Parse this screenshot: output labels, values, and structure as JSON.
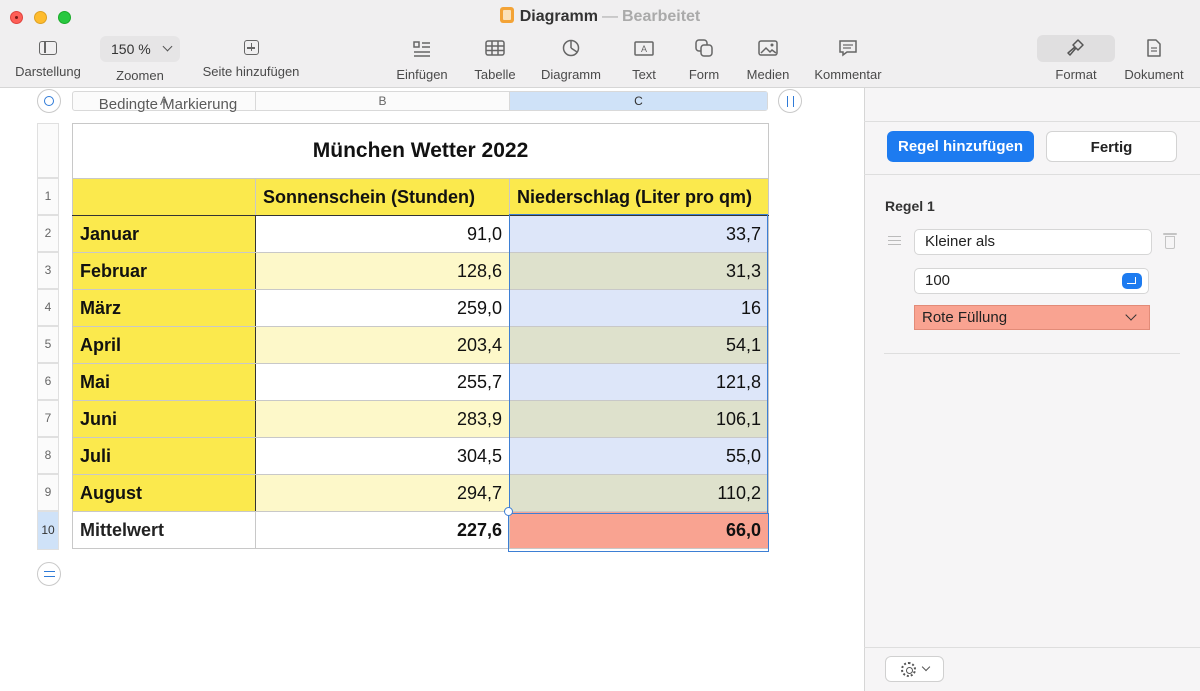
{
  "window": {
    "title": "Diagramm",
    "separator": "—",
    "status": "Bearbeitet"
  },
  "toolbar": {
    "zoom_value": "150 %",
    "items": {
      "darstellung": "Darstellung",
      "zoomen": "Zoomen",
      "seite_hinzufuegen": "Seite hinzufügen",
      "einfuegen": "Einfügen",
      "tabelle": "Tabelle",
      "diagramm": "Diagramm",
      "text": "Text",
      "form": "Form",
      "medien": "Medien",
      "kommentar": "Kommentar",
      "format": "Format",
      "dokument": "Dokument"
    }
  },
  "sheet": {
    "column_headers": [
      "A",
      "B",
      "C"
    ],
    "row_numbers": [
      "1",
      "2",
      "3",
      "4",
      "5",
      "6",
      "7",
      "8",
      "9",
      "10"
    ],
    "title": "München Wetter 2022",
    "headers": [
      "",
      "Sonnenschein (Stunden)",
      "Niederschlag (Liter pro qm)"
    ],
    "rows": [
      [
        "Januar",
        "91,0",
        "33,7"
      ],
      [
        "Februar",
        "128,6",
        "31,3"
      ],
      [
        "März",
        "259,0",
        "16"
      ],
      [
        "April",
        "203,4",
        "54,1"
      ],
      [
        "Mai",
        "255,7",
        "121,8"
      ],
      [
        "Juni",
        "283,9",
        "106,1"
      ],
      [
        "Juli",
        "304,5",
        "55,0"
      ],
      [
        "August",
        "294,7",
        "110,2"
      ]
    ],
    "footer": [
      "Mittelwert",
      "227,6",
      "66,0"
    ]
  },
  "panel": {
    "title": "Bedingte Markierung",
    "add_rule_label": "Regel hinzufügen",
    "done_label": "Fertig",
    "rule_title": "Regel 1",
    "condition": "Kleiner als",
    "value": "100",
    "style": "Rote Füllung"
  },
  "icons": {
    "sidebar": "sidebar-icon",
    "add_page": "plus-square-icon",
    "insert": "list-icon",
    "table": "table-icon",
    "chart": "chart-icon",
    "text": "textbox-icon",
    "shape": "shape-icon",
    "media": "photo-icon",
    "comment": "comment-icon",
    "format": "paintbrush-icon",
    "document": "document-icon"
  }
}
